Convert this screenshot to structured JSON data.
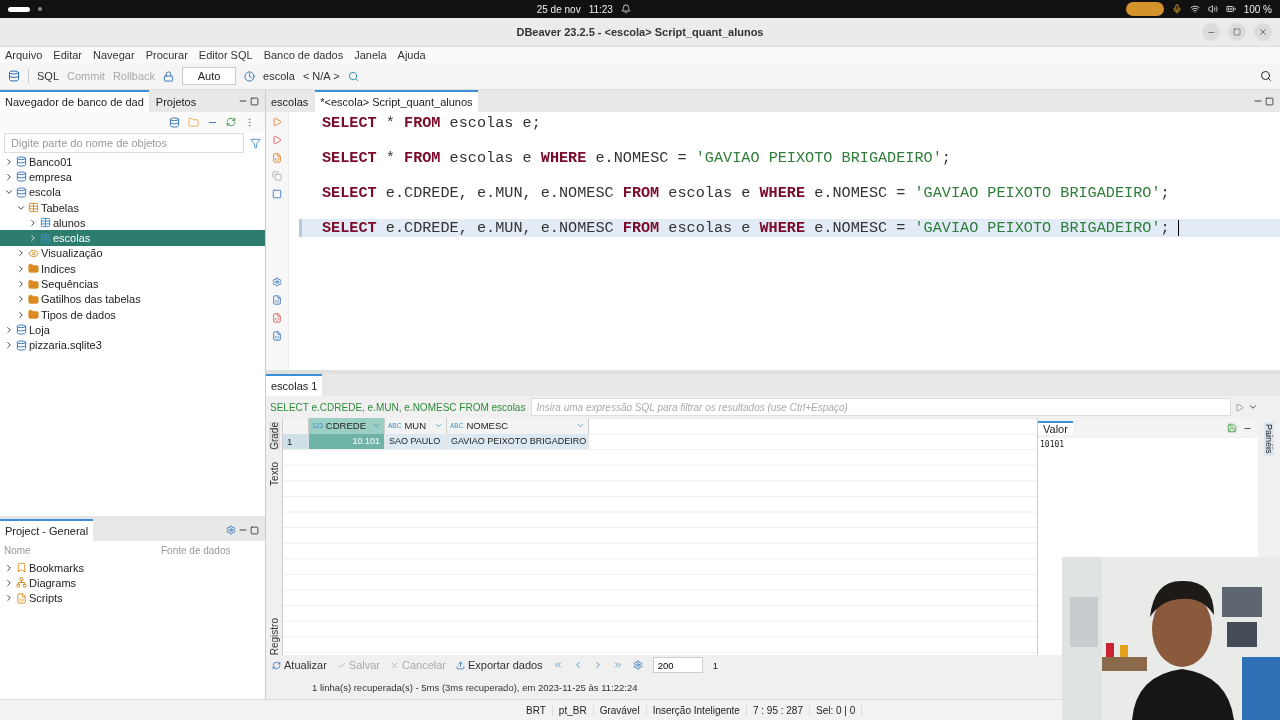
{
  "system_bar": {
    "date": "25 de nov",
    "time": "11:23",
    "battery": "100 %"
  },
  "window": {
    "title": "DBeaver 23.2.5 - <escola> Script_quant_alunos"
  },
  "menu": [
    "Arquivo",
    "Editar",
    "Navegar",
    "Procurar",
    "Editor SQL",
    "Banco de dados",
    "Janela",
    "Ajuda"
  ],
  "toolbar": {
    "buttons": [
      {
        "label": "SQL",
        "disabled": false
      },
      {
        "label": "Commit",
        "disabled": true
      },
      {
        "label": "Rollback",
        "disabled": true
      }
    ],
    "mode": "Auto",
    "database": "escola",
    "schema": "< N/A >"
  },
  "navigator": {
    "tabs": [
      {
        "label": "Navegador de banco de dad",
        "selected": true
      },
      {
        "label": "Projetos",
        "selected": false
      }
    ],
    "search": {
      "placeholder": "Digite parte do nome de objetos"
    },
    "tree": [
      {
        "label": "Banco01",
        "kind": "database",
        "expanded": false,
        "selected": false
      },
      {
        "label": "empresa",
        "kind": "database",
        "expanded": false,
        "selected": false
      },
      {
        "label": "escola",
        "kind": "database",
        "expanded": true,
        "selected": false,
        "children": [
          {
            "label": "Tabelas",
            "kind": "tables",
            "expanded": true,
            "selected": false,
            "children": [
              {
                "label": "alunos",
                "kind": "table",
                "expanded": false,
                "selected": false
              },
              {
                "label": "escolas",
                "kind": "table",
                "expanded": false,
                "selected": true
              }
            ]
          },
          {
            "label": "Visualização",
            "kind": "view",
            "expanded": false,
            "selected": false
          },
          {
            "label": "Indices",
            "kind": "folder",
            "expanded": false,
            "selected": false
          },
          {
            "label": "Sequências",
            "kind": "folder",
            "expanded": false,
            "selected": false
          },
          {
            "label": "Gatilhos das tabelas",
            "kind": "folder",
            "expanded": false,
            "selected": false
          },
          {
            "label": "Tipos de dados",
            "kind": "folder",
            "expanded": false,
            "selected": false
          }
        ]
      },
      {
        "label": "Loja",
        "kind": "database",
        "expanded": false,
        "selected": false
      },
      {
        "label": "pizzaria.sqlite3",
        "kind": "database",
        "expanded": false,
        "selected": false
      }
    ]
  },
  "projects": {
    "tab": "Project - General",
    "columns": [
      "Nome",
      "Fonte de dados"
    ],
    "items": [
      {
        "label": "Bookmarks",
        "kind": "bookmarks",
        "expanded": false
      },
      {
        "label": "Diagrams",
        "kind": "diagrams",
        "expanded": false
      },
      {
        "label": "Scripts",
        "kind": "scripts",
        "expanded": false
      }
    ]
  },
  "editor": {
    "tabs": [
      {
        "label": "escolas",
        "selected": false
      },
      {
        "label": "*<escola> Script_quant_alunos",
        "selected": true
      }
    ],
    "lines": [
      {
        "current": false,
        "tokens": [
          {
            "kind": "keyword",
            "text": "SELECT"
          },
          {
            "kind": "plain",
            "text": " * "
          },
          {
            "kind": "keyword",
            "text": "FROM"
          },
          {
            "kind": "plain",
            "text": " escolas e;"
          }
        ]
      },
      {
        "current": false,
        "tokens": [
          {
            "kind": "keyword",
            "text": "SELECT"
          },
          {
            "kind": "plain",
            "text": " * "
          },
          {
            "kind": "keyword",
            "text": "FROM"
          },
          {
            "kind": "plain",
            "text": " escolas e "
          },
          {
            "kind": "keyword",
            "text": "WHERE"
          },
          {
            "kind": "plain",
            "text": " e.NOMESC = "
          },
          {
            "kind": "string",
            "text": "'GAVIAO PEIXOTO BRIGADEIRO'"
          },
          {
            "kind": "plain",
            "text": ";"
          }
        ]
      },
      {
        "current": false,
        "tokens": [
          {
            "kind": "keyword",
            "text": "SELECT"
          },
          {
            "kind": "plain",
            "text": " e.CDREDE, e.MUN, e.NOMESC "
          },
          {
            "kind": "keyword",
            "text": "FROM"
          },
          {
            "kind": "plain",
            "text": " escolas e "
          },
          {
            "kind": "keyword",
            "text": "WHERE"
          },
          {
            "kind": "plain",
            "text": " e.NOMESC = "
          },
          {
            "kind": "string",
            "text": "'GAVIAO PEIXOTO BRIGADEIRO'"
          },
          {
            "kind": "plain",
            "text": ";"
          }
        ]
      },
      {
        "current": true,
        "tokens": [
          {
            "kind": "keyword",
            "text": "SELECT"
          },
          {
            "kind": "plain",
            "text": " e.CDREDE, e.MUN, e.NOMESC "
          },
          {
            "kind": "keyword",
            "text": "FROM"
          },
          {
            "kind": "plain",
            "text": " escolas e "
          },
          {
            "kind": "keyword",
            "text": "WHERE"
          },
          {
            "kind": "plain",
            "text": " e.NOMESC = "
          },
          {
            "kind": "string",
            "text": "'GAVIAO PEIXOTO BRIGADEIRO'"
          },
          {
            "kind": "plain",
            "text": ";"
          }
        ]
      }
    ]
  },
  "results": {
    "tab": "escolas 1",
    "query": "SELECT e.CDREDE, e.MUN, e.NOMESC FROM escolas",
    "filter": {
      "placeholder": "Insira uma expressão SQL para filtrar os resultados (use Ctrl+Espaço)"
    },
    "side_tabs": [
      {
        "label": "Grade",
        "selected": true
      },
      {
        "label": "Texto",
        "selected": false
      },
      {
        "label": "Registro",
        "selected": false
      }
    ],
    "columns": [
      {
        "name": "CDREDE",
        "type": "123"
      },
      {
        "name": "MUN",
        "type": "ABC"
      },
      {
        "name": "NOMESC",
        "type": "ABC"
      }
    ],
    "rows": [
      {
        "number": "1",
        "cells": [
          {
            "value": "10.101",
            "selected": true
          },
          {
            "value": "SAO PAULO",
            "selected": false
          },
          {
            "value": "GAVIAO PEIXOTO BRIGADEIRO",
            "selected": false
          }
        ]
      }
    ],
    "value_panel": {
      "title": "Valor",
      "value": "10101"
    },
    "panels_label": "Painéis",
    "actions": [
      {
        "label": "Atualizar",
        "disabled": false
      },
      {
        "label": "Salvar",
        "disabled": true
      },
      {
        "label": "Cancelar",
        "disabled": true
      },
      {
        "label": "Exportar dados",
        "disabled": false
      }
    ],
    "fetch_size": "200",
    "row_count": "1",
    "message": "1 linha(s) recuperada(s) - 5ms (3ms recuperado), em 2023-11-25 às 11:22:24"
  },
  "status_bar": [
    "BRT",
    "pt_BR",
    "Gravável",
    "Inserção Inteligente",
    "7 : 95 : 287",
    "Sel: 0 | 0"
  ]
}
